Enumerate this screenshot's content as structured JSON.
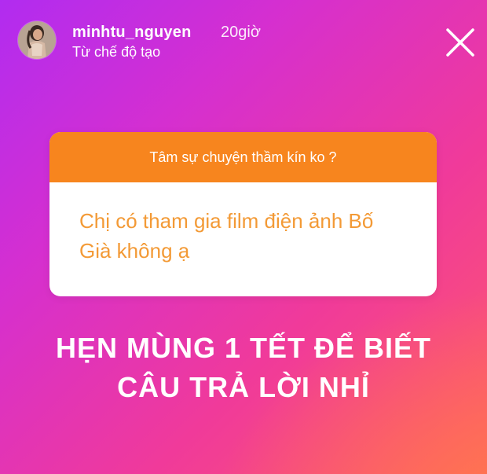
{
  "header": {
    "username": "minhtu_nguyen",
    "time_ago": "20giờ",
    "create_mode_label": "Từ chế độ tạo"
  },
  "question_sticker": {
    "prompt": "Tâm sự chuyện thầm kín ko ?",
    "question_line1": "Chị có tham gia film điện ảnh Bố",
    "question_line2": "Già không ạ",
    "header_color": "#f7851e",
    "question_color": "#f39a36"
  },
  "answer": {
    "line1": "HẸN MÙNG 1 TẾT ĐỂ BIẾT",
    "line2": "CÂU TRẢ LỜI NHỈ"
  },
  "icons": {
    "close": "close-icon",
    "avatar": "avatar"
  }
}
